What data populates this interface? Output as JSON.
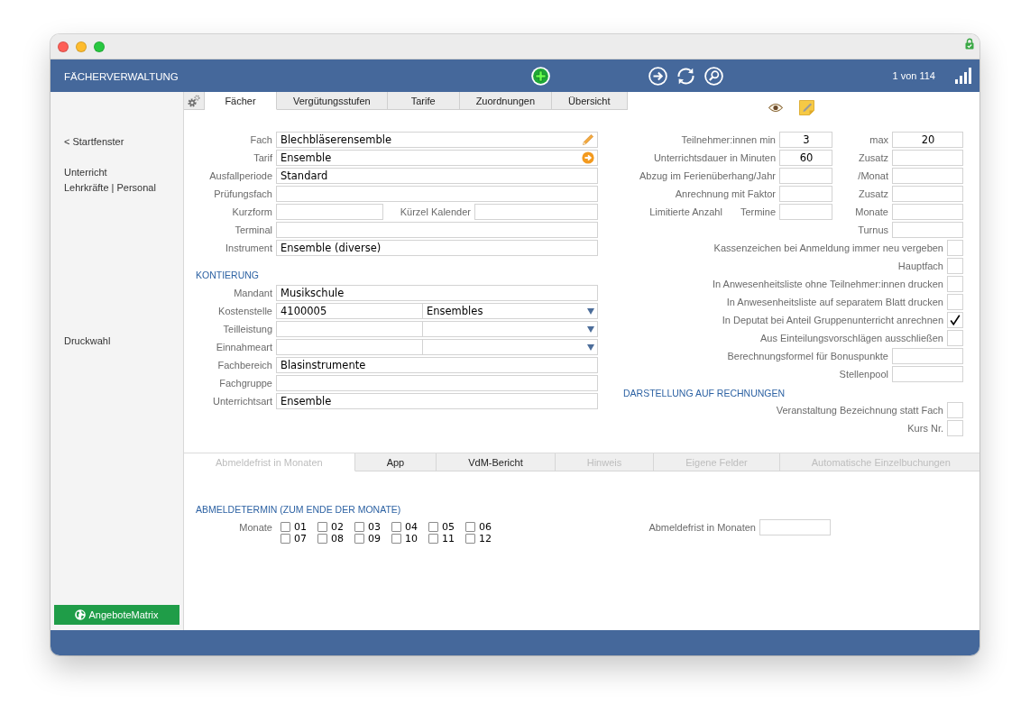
{
  "header": {
    "title": "FÄCHERVERWALTUNG",
    "record_counter": "1 von 114"
  },
  "sidebar": {
    "navigation": [
      "< Startfenster"
    ],
    "modules": [
      "Unterricht",
      "Lehrkräfte | Personal"
    ],
    "actions": [
      "Druckwahl"
    ],
    "button": "AngeboteMatrix"
  },
  "main_tabs": [
    {
      "label": "Fächer",
      "selected": true
    },
    {
      "label": "Vergütungsstufen",
      "selected": false
    },
    {
      "label": "Tarife",
      "selected": false
    },
    {
      "label": "Zuordnungen",
      "selected": false
    },
    {
      "label": "Übersicht",
      "selected": false
    }
  ],
  "general": {
    "rows": [
      {
        "kind": "edit",
        "label": "Fach",
        "value": "Blechbläserensemble"
      },
      {
        "kind": "link",
        "label": "Tarif",
        "value": "Ensemble"
      },
      {
        "kind": "text",
        "label": "Ausfallperiode",
        "value": "Standard"
      },
      {
        "kind": "text",
        "label": "Prüfungsfach"
      },
      {
        "kind": "pair",
        "label": "Kurzform",
        "second_label": "Kürzel Kalender"
      },
      {
        "kind": "text",
        "label": "Terminal"
      },
      {
        "kind": "text",
        "label": "Instrument",
        "value": "Ensemble (diverse)"
      }
    ]
  },
  "kontierung": {
    "heading": "KONTIERUNG",
    "rows": [
      {
        "kind": "text",
        "label": "Mandant",
        "value": "Musikschule"
      },
      {
        "kind": "split",
        "label": "Kostenstelle",
        "value": "4100005",
        "option": "Ensembles"
      },
      {
        "kind": "split",
        "label": "Teilleistung"
      },
      {
        "kind": "split",
        "label": "Einnahmeart"
      },
      {
        "kind": "text",
        "label": "Fachbereich",
        "value": "Blasinstrumente"
      },
      {
        "kind": "text",
        "label": "Fachgruppe"
      },
      {
        "kind": "text",
        "label": "Unterrichtsart",
        "value": "Ensemble"
      }
    ]
  },
  "limits": {
    "rows": [
      {
        "label": "Teilnehmer:innen min",
        "value": "3",
        "second_label": "max",
        "second_value": "20"
      },
      {
        "label": "Unterrichtsdauer in Minuten",
        "value": "60",
        "second_label": "Zusatz"
      },
      {
        "label": "Abzug im Ferienüberhang/Jahr",
        "second_label": "/Monat"
      },
      {
        "label": "Anrechnung mit Faktor",
        "second_label": "Zusatz"
      },
      {
        "prefix": "Limitierte Anzahl",
        "label": "Termine",
        "second_label": "Monate"
      },
      {
        "second_label": "Turnus"
      }
    ]
  },
  "options": [
    {
      "kind": "checkbox",
      "label": "Kassenzeichen bei Anmeldung immer neu vergeben",
      "checked": false
    },
    {
      "kind": "checkbox",
      "label": "Hauptfach",
      "checked": false
    },
    {
      "kind": "checkbox",
      "label": "In Anwesenheitsliste ohne Teilnehmer:innen drucken",
      "checked": false
    },
    {
      "kind": "checkbox",
      "label": "In Anwesenheitsliste auf separatem Blatt drucken",
      "checked": false
    },
    {
      "kind": "checkbox",
      "label": "In Deputat bei Anteil Gruppenunterricht anrechnen",
      "checked": true
    },
    {
      "kind": "checkbox",
      "label": "Aus Einteilungsvorschlägen ausschließen",
      "checked": false
    },
    {
      "kind": "field",
      "label": "Berechnungsformel für Bonuspunkte"
    },
    {
      "kind": "field",
      "label": "Stellenpool"
    }
  ],
  "invoice": {
    "heading": "DARSTELLUNG AUF RECHNUNGEN",
    "options": [
      {
        "kind": "checkbox",
        "label": "Veranstaltung Bezeichnung statt Fach",
        "checked": false
      },
      {
        "kind": "checkbox",
        "label": "Kurs Nr.",
        "checked": false
      }
    ]
  },
  "detail_tabs": [
    {
      "label": "Abmeldefrist in Monaten",
      "selected": true,
      "disabled": true
    },
    {
      "label": "App",
      "selected": false,
      "disabled": false
    },
    {
      "label": "VdM-Bericht",
      "selected": false,
      "disabled": false
    },
    {
      "label": "Hinweis",
      "selected": false,
      "disabled": true
    },
    {
      "label": "Eigene Felder",
      "selected": false,
      "disabled": true
    },
    {
      "label": "Automatische Einzelbuchungen",
      "selected": false,
      "disabled": true
    }
  ],
  "cancellation": {
    "heading": "ABMELDETERMIN (ZUM ENDE DER MONATE)",
    "months_label": "Monate",
    "months": [
      {
        "label": "01",
        "checked": false
      },
      {
        "label": "02",
        "checked": false
      },
      {
        "label": "03",
        "checked": false
      },
      {
        "label": "04",
        "checked": false
      },
      {
        "label": "05",
        "checked": false
      },
      {
        "label": "06",
        "checked": false
      },
      {
        "label": "07",
        "checked": false
      },
      {
        "label": "08",
        "checked": false
      },
      {
        "label": "09",
        "checked": false
      },
      {
        "label": "10",
        "checked": false
      },
      {
        "label": "11",
        "checked": false
      },
      {
        "label": "12",
        "checked": false
      }
    ],
    "period_label": "Abmeldefrist in Monaten"
  }
}
